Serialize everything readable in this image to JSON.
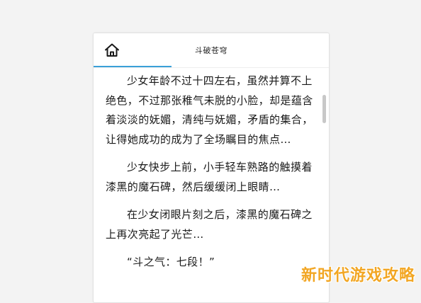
{
  "header": {
    "title": "斗破苍穹",
    "home_icon": "home-icon"
  },
  "content": {
    "paragraphs": [
      "少女年龄不过十四左右，虽然并算不上绝色，不过那张稚气未脱的小脸，却是蕴含着淡淡的妩媚，清纯与妩媚，矛盾的集合，让得她成功的成为了全场瞩目的焦点…",
      "少女快步上前，小手轻车熟路的触摸着漆黑的魔石碑，然后缓缓闭上眼睛…",
      "在少女闭眼片刻之后，漆黑的魔石碑之上再次亮起了光芒…",
      "“斗之气：七段！”"
    ]
  },
  "watermark": "新时代游戏攻略",
  "colors": {
    "accent": "#3aa0d8",
    "watermark": "#f2a623"
  }
}
